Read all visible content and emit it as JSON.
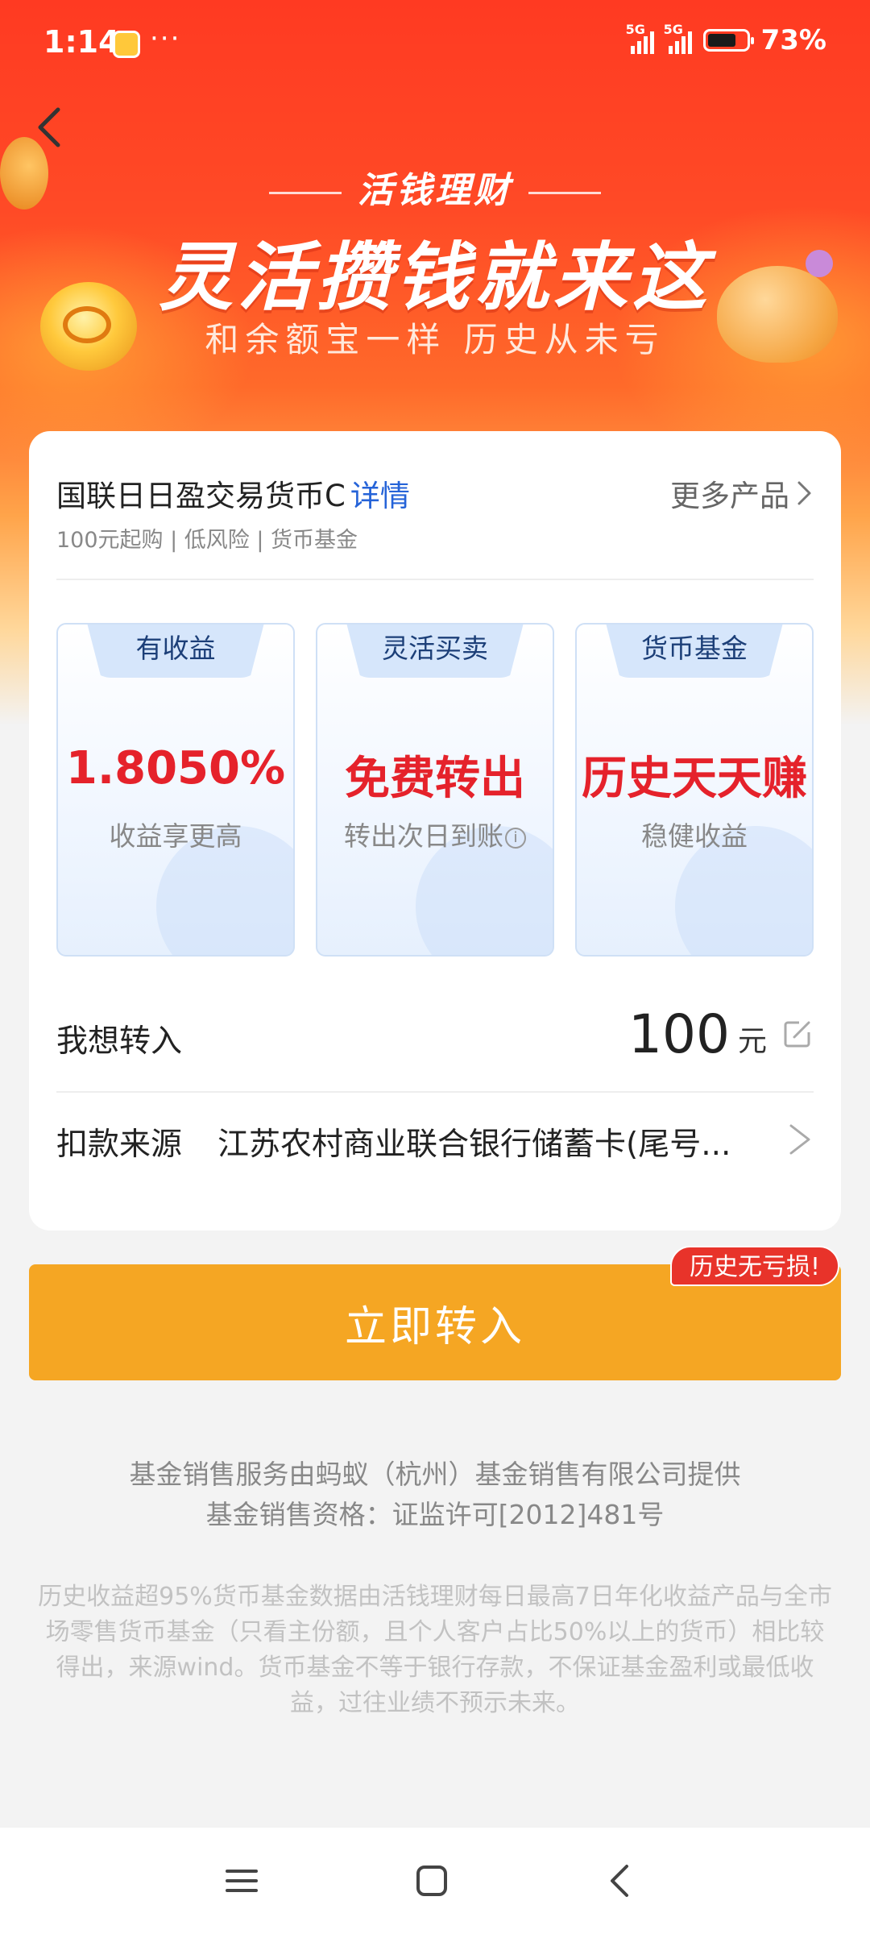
{
  "status_bar": {
    "time": "1:14",
    "dots": "···",
    "signal1": "5G",
    "signal2": "5G",
    "battery": "73%"
  },
  "hero": {
    "kicker": "活钱理财",
    "title": "灵活攒钱就来这",
    "subtitle": "和余额宝一样 历史从未亏"
  },
  "product": {
    "name": "国联日日盈交易货币C",
    "detail_link": "详情",
    "more_products": "更多产品",
    "meta": "100元起购 | 低风险 | 货币基金"
  },
  "features": [
    {
      "tab": "有收益",
      "big": "1.8050%",
      "small": "收益享更高"
    },
    {
      "tab": "灵活买卖",
      "big": "免费转出",
      "small": "转出次日到账"
    },
    {
      "tab": "货币基金",
      "big": "历史天天赚",
      "small": "稳健收益"
    }
  ],
  "info_glyph": "i",
  "transfer": {
    "label": "我想转入",
    "amount": "100",
    "unit": "元"
  },
  "payment": {
    "label": "扣款来源",
    "value": "江苏农村商业联合银行储蓄卡(尾号..."
  },
  "cta": {
    "label": "立即转入",
    "badge": "历史无亏损!"
  },
  "provider": {
    "line1": "基金销售服务由蚂蚁（杭州）基金销售有限公司提供",
    "line2": "基金销售资格：证监许可[2012]481号"
  },
  "disclaimer": "历史收益超95%货币基金数据由活钱理财每日最高7日年化收益产品与全市场零售货币基金（只看主份额，且个人客户占比50%以上的货币）相比较得出，来源wind。货币基金不等于银行存款，不保证基金盈利或最低收益，过往业绩不预示未来。",
  "colors": {
    "hero_red": "#ff3a22",
    "accent_red": "#e5222b",
    "cta_orange": "#f5a623",
    "link_blue": "#2563d8"
  }
}
